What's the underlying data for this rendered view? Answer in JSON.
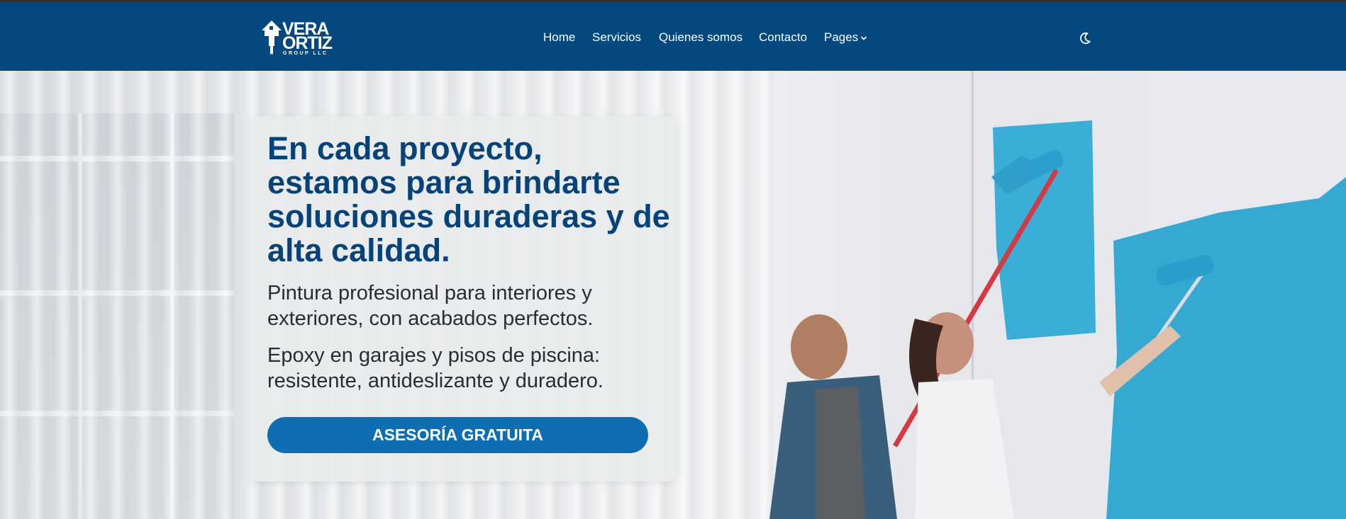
{
  "brand": {
    "logo_line1": "VERA",
    "logo_line2": "ORTIZ",
    "logo_sub": "GROUP LLC",
    "primary_color": "#03497f",
    "accent_color": "#0d6eb2"
  },
  "nav": {
    "items": [
      {
        "label": "Home"
      },
      {
        "label": "Servicios"
      },
      {
        "label": "Quienes somos"
      },
      {
        "label": "Contacto"
      },
      {
        "label": "Pages"
      }
    ],
    "theme_toggle_icon": "moon-icon"
  },
  "hero": {
    "headline": "En cada proyecto, estamos para brindarte soluciones duraderas y de alta calidad.",
    "paragraph1": "Pintura profesional para interiores y exteriores, con acabados perfectos.",
    "paragraph2": "Epoxy en garajes y pisos de piscina: resistente, antideslizante y duradero.",
    "cta_label": "ASESORÍA GRATUITA"
  }
}
